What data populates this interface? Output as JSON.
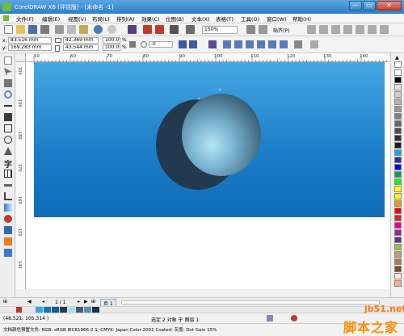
{
  "window": {
    "title": "CorelDRAW X6 (评估版) - [未命名 -1]",
    "minimize": "—",
    "maximize": "▭",
    "close": "✕"
  },
  "menu": {
    "items": [
      "文件(F)",
      "编辑(E)",
      "视图(V)",
      "布局(L)",
      "排列(A)",
      "效果(C)",
      "位图(B)",
      "文本(X)",
      "表格(T)",
      "工具(O)",
      "窗口(W)",
      "帮助(H)"
    ]
  },
  "standard_toolbar": {
    "zoom_value": "150%",
    "snap_label": "贴齐(P)"
  },
  "property_bar": {
    "x_label": "x:",
    "x_value": "83.516 mm",
    "y_label": "y:",
    "y_value": "169.283 mm",
    "w_value": "42.369 mm",
    "h_value": "43.544 mm",
    "scale_w": "100.0",
    "scale_h": "100.0",
    "percent": "%",
    "rotation": ".0"
  },
  "ruler": {
    "h_ticks": [
      "50",
      "60",
      "70",
      "80",
      "90",
      "100",
      "110",
      "120",
      "130",
      "140"
    ],
    "v_ticks": [
      "200",
      "190",
      "180",
      "170",
      "160",
      "150",
      "140"
    ],
    "unit": "毫米"
  },
  "doc_nav": {
    "page_count": "1 / 1",
    "page_tab": "页 1"
  },
  "status": {
    "coords": "(48.521, 105.314 )",
    "selection": "选定 2 对象 于 图层 1"
  },
  "profile": {
    "text": "文档颜色预置文件: RGB: sRGB IEC61966-2.1; CMYK: Japan Color 2001 Coated; 灰度: Dot Gain 15%"
  },
  "watermark": {
    "site": "jb51.net",
    "brand": "脚本之家"
  },
  "colors": {
    "title_bar": "#3c8dd0",
    "page_bg_top": "#46a8e2",
    "page_bg_bottom": "#0f6cb7",
    "dark_circle": "#233a4e",
    "light_circle_center": "#a7dcee",
    "light_circle_edge": "#3a5f77"
  },
  "palette_swatches": [
    "#ffffff",
    "#000000",
    "#e6e6e6",
    "#cccccc",
    "#b3b3b3",
    "#999999",
    "#808080",
    "#666666",
    "#4d4d4d",
    "#333333",
    "#1a1a1a",
    "#00aeef",
    "#2e3192",
    "#0000ff",
    "#00a651",
    "#00ff00",
    "#ffff00",
    "#fff200",
    "#f7941d",
    "#ff0000",
    "#ed1c24",
    "#ec008c",
    "#92278f",
    "#662d91",
    "#8dc63f",
    "#c69c6d",
    "#a67c52",
    "#754c24",
    "#ffe6cc",
    "#f9ad81"
  ],
  "doc_palette": [
    "#3aa4e0",
    "#1273b6",
    "#0f5a92",
    "#233a4e",
    "#a7dcee",
    "#3a5f77",
    "#5b8fae",
    "#16324a"
  ]
}
